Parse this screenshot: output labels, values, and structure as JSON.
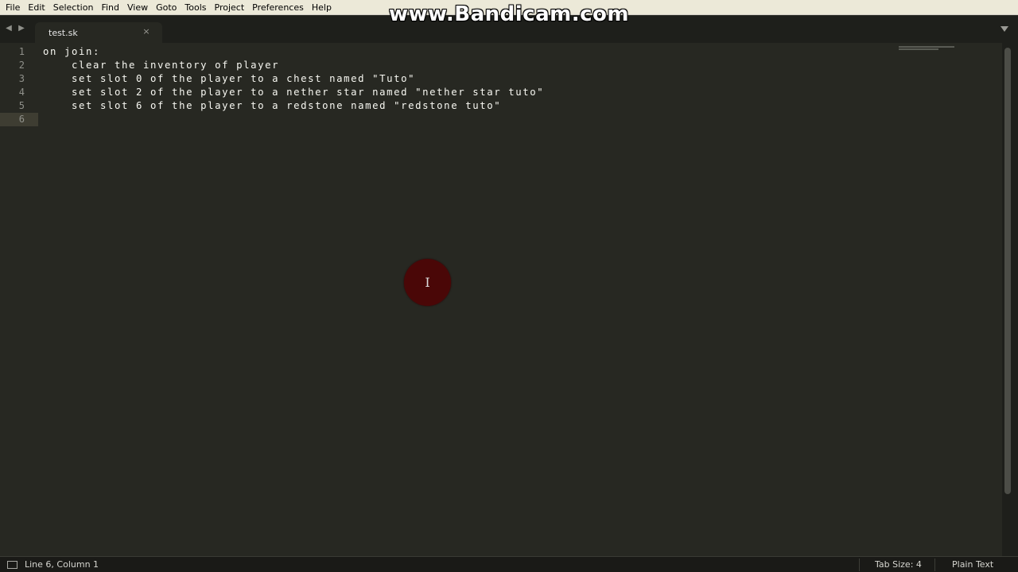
{
  "menubar": {
    "items": [
      "File",
      "Edit",
      "Selection",
      "Find",
      "View",
      "Goto",
      "Tools",
      "Project",
      "Preferences",
      "Help"
    ]
  },
  "watermark": "www.Bandicam.com",
  "tabs": [
    {
      "label": "test.sk",
      "close": "×",
      "active": true
    }
  ],
  "editor": {
    "line_numbers": [
      "1",
      "2",
      "3",
      "4",
      "5",
      "6"
    ],
    "lines": [
      "on join:",
      "    clear the inventory of player",
      "    set slot 0 of the player to a chest named \"Tuto\"",
      "    set slot 2 of the player to a nether star named \"nether star tuto\"",
      "    set slot 6 of the player to a redstone named \"redstone tuto\"",
      ""
    ],
    "current_line": 6
  },
  "statusbar": {
    "position": "Line 6, Column 1",
    "tab_size": "Tab Size: 4",
    "syntax": "Plain Text"
  },
  "colors": {
    "background": "#272822",
    "foreground": "#f8f8f2",
    "gutter_text": "#8f908a",
    "menubar": "#ece9d8",
    "cursor_highlight": "#4a0707"
  },
  "icons": {
    "nav_back": "chevron-left-icon",
    "nav_forward": "chevron-right-icon",
    "tab_close": "close-icon",
    "tab_menu": "caret-down-icon",
    "status_panel": "panel-icon",
    "cursor": "ibeam-cursor-icon"
  }
}
